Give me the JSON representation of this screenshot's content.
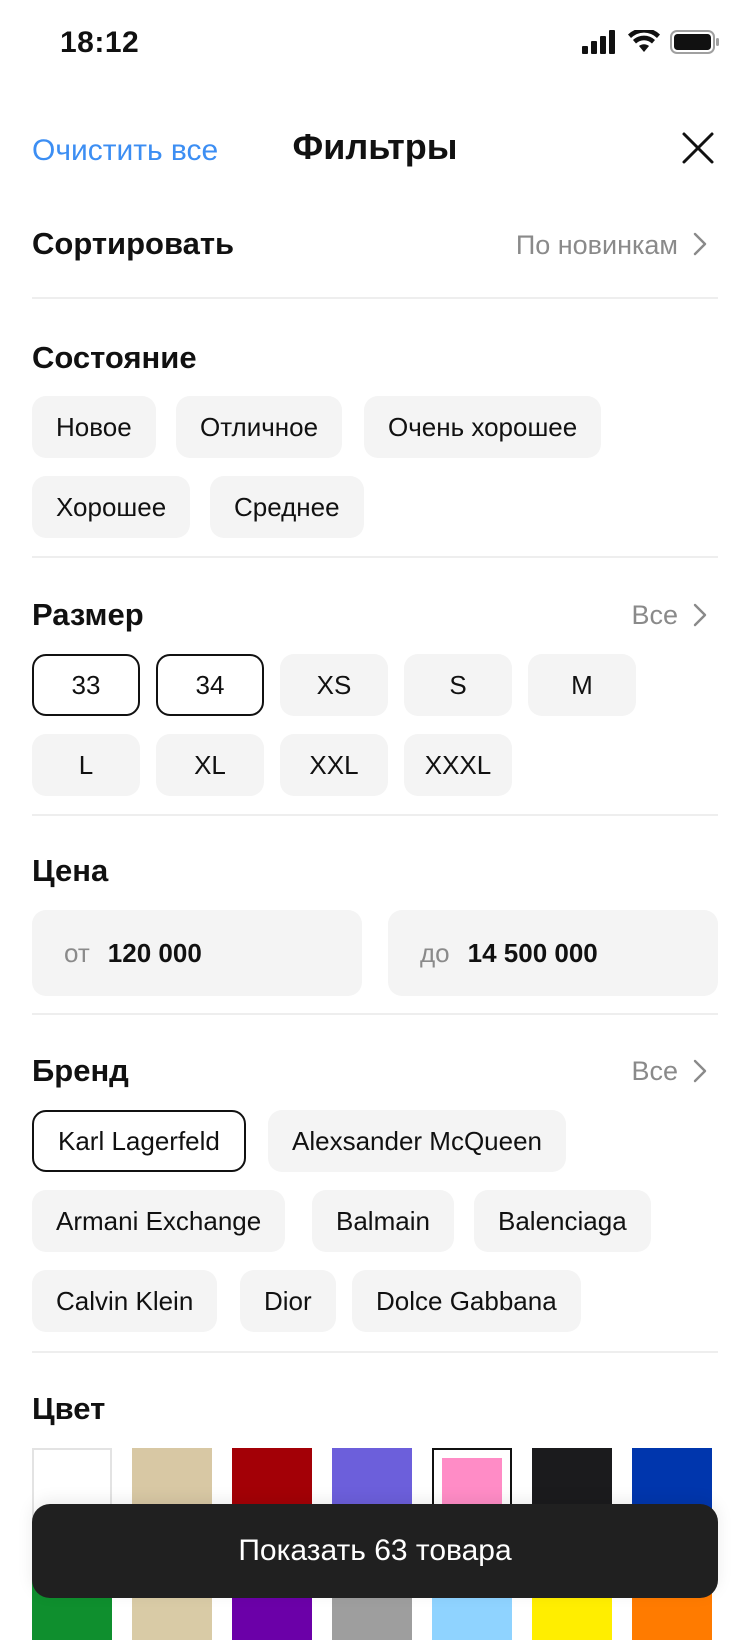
{
  "status_bar": {
    "time": "18:12"
  },
  "header": {
    "clear_label": "Очистить все",
    "title": "Фильтры"
  },
  "sort": {
    "title": "Сортировать",
    "value": "По новинкам"
  },
  "condition": {
    "title": "Состояние",
    "options": [
      "Новое",
      "Отличное",
      "Очень хорошее",
      "Хорошее",
      "Среднее"
    ]
  },
  "size": {
    "title": "Размер",
    "all_label": "Все",
    "options": [
      "33",
      "34",
      "XS",
      "S",
      "M",
      "L",
      "XL",
      "XXL",
      "XXXL"
    ],
    "selected": [
      "33",
      "34"
    ]
  },
  "price": {
    "title": "Цена",
    "from_label": "от",
    "from_value": "120 000",
    "to_label": "до",
    "to_value": "14 500 000"
  },
  "brand": {
    "title": "Бренд",
    "all_label": "Все",
    "options": [
      "Karl Lagerfeld",
      "Alexsander McQueen",
      "Armani Exchange",
      "Balmain",
      "Balenciaga",
      "Calvin Klein",
      "Dior",
      "Dolce Gabbana"
    ],
    "selected": [
      "Karl Lagerfeld"
    ]
  },
  "color": {
    "title": "Цвет",
    "swatches_row1": [
      "#ffffff",
      "#d8c8a4",
      "#a30006",
      "#6c5fdb",
      "#ff8cc6",
      "#1b1b1d",
      "#0036ad"
    ],
    "swatches_row2": [
      "#0f8f2e",
      "#d9cba6",
      "#6b00a8",
      "#9e9e9e",
      "#8fd3ff",
      "#ffee00",
      "#ff7b00"
    ],
    "selected_index": 4
  },
  "show_button": {
    "label": "Показать 63 товара"
  }
}
